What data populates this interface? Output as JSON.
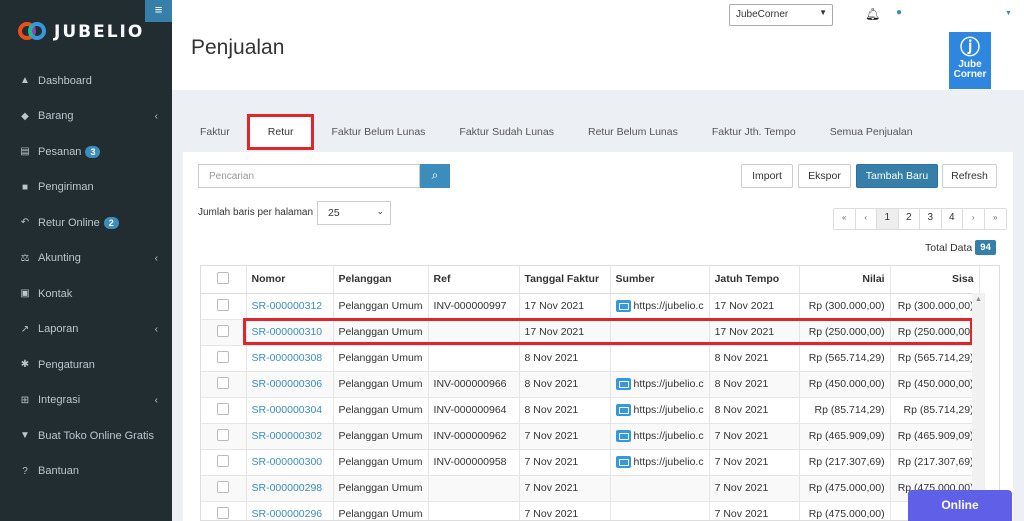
{
  "brand": {
    "name": "JUBELIO"
  },
  "topbar": {
    "store": "JubeCorner",
    "user_name": ""
  },
  "page": {
    "title": "Penjualan",
    "store_logo_text": "Jube Corner"
  },
  "sidebar": {
    "items": [
      {
        "label": "Dashboard",
        "icon": "area-chart-icon",
        "glyph": "▲",
        "badge": "",
        "has_children": false
      },
      {
        "label": "Barang",
        "icon": "cubes-icon",
        "glyph": "◆",
        "badge": "",
        "has_children": true
      },
      {
        "label": "Pesanan",
        "icon": "basket-icon",
        "glyph": "▤",
        "badge": "3",
        "has_children": false
      },
      {
        "label": "Pengiriman",
        "icon": "truck-icon",
        "glyph": "■",
        "badge": "",
        "has_children": false
      },
      {
        "label": "Retur Online",
        "icon": "reply-icon",
        "glyph": "↶",
        "badge": "2",
        "has_children": false
      },
      {
        "label": "Akunting",
        "icon": "balance-scale-icon",
        "glyph": "⚖",
        "badge": "",
        "has_children": true
      },
      {
        "label": "Kontak",
        "icon": "address-card-icon",
        "glyph": "▣",
        "badge": "",
        "has_children": false
      },
      {
        "label": "Laporan",
        "icon": "line-chart-icon",
        "glyph": "↗",
        "badge": "",
        "has_children": true
      },
      {
        "label": "Pengaturan",
        "icon": "gears-icon",
        "glyph": "✱",
        "badge": "",
        "has_children": false
      },
      {
        "label": "Integrasi",
        "icon": "sitemap-icon",
        "glyph": "⊞",
        "badge": "",
        "has_children": true
      },
      {
        "label": "Buat Toko Online Gratis",
        "icon": "cart-icon",
        "glyph": "▼",
        "badge": "",
        "has_children": false
      },
      {
        "label": "Bantuan",
        "icon": "question-circle-icon",
        "glyph": "?",
        "badge": "",
        "has_children": false
      }
    ]
  },
  "tabs": [
    {
      "label": "Faktur",
      "active": false
    },
    {
      "label": "Retur",
      "active": true
    },
    {
      "label": "Faktur Belum Lunas",
      "active": false
    },
    {
      "label": "Faktur Sudah Lunas",
      "active": false
    },
    {
      "label": "Retur Belum Lunas",
      "active": false
    },
    {
      "label": "Faktur Jth. Tempo",
      "active": false
    },
    {
      "label": "Semua Penjualan",
      "active": false
    }
  ],
  "toolbar": {
    "search_placeholder": "Pencarian",
    "import_label": "Import",
    "export_label": "Ekspor",
    "add_label": "Tambah Baru",
    "refresh_label": "Refresh"
  },
  "rows_per_page": {
    "label": "Jumlah baris per halaman",
    "value": "25"
  },
  "pagination": {
    "first": "«",
    "prev": "‹",
    "pages": [
      "1",
      "2",
      "3",
      "4"
    ],
    "current": "1",
    "next": "›",
    "last": "»"
  },
  "total": {
    "label": "Total Data",
    "count": "94"
  },
  "table": {
    "columns": [
      "Nomor",
      "Pelanggan",
      "Ref",
      "Tanggal Faktur",
      "Sumber",
      "Jatuh Tempo",
      "Nilai",
      "Sisa"
    ],
    "rows": [
      {
        "nomor": "SR-000000312",
        "pelanggan": "Pelanggan Umum",
        "ref": "INV-000000997",
        "tanggal": "17 Nov 2021",
        "sumber": "https://jubelio.c",
        "jatuh_tempo": "17 Nov 2021",
        "nilai": "Rp (300.000,00)",
        "sisa": "Rp (300.000,00)"
      },
      {
        "nomor": "SR-000000310",
        "pelanggan": "Pelanggan Umum",
        "ref": "",
        "tanggal": "17 Nov 2021",
        "sumber": "",
        "jatuh_tempo": "17 Nov 2021",
        "nilai": "Rp (250.000,00)",
        "sisa": "Rp (250.000,00)"
      },
      {
        "nomor": "SR-000000308",
        "pelanggan": "Pelanggan Umum",
        "ref": "",
        "tanggal": "8 Nov 2021",
        "sumber": "",
        "jatuh_tempo": "8 Nov 2021",
        "nilai": "Rp (565.714,29)",
        "sisa": "Rp (565.714,29)"
      },
      {
        "nomor": "SR-000000306",
        "pelanggan": "Pelanggan Umum",
        "ref": "INV-000000966",
        "tanggal": "8 Nov 2021",
        "sumber": "https://jubelio.c",
        "jatuh_tempo": "8 Nov 2021",
        "nilai": "Rp (450.000,00)",
        "sisa": "Rp (450.000,00)"
      },
      {
        "nomor": "SR-000000304",
        "pelanggan": "Pelanggan Umum",
        "ref": "INV-000000964",
        "tanggal": "8 Nov 2021",
        "sumber": "https://jubelio.c",
        "jatuh_tempo": "8 Nov 2021",
        "nilai": "Rp (85.714,29)",
        "sisa": "Rp (85.714,29)"
      },
      {
        "nomor": "SR-000000302",
        "pelanggan": "Pelanggan Umum",
        "ref": "INV-000000962",
        "tanggal": "7 Nov 2021",
        "sumber": "https://jubelio.c",
        "jatuh_tempo": "7 Nov 2021",
        "nilai": "Rp (465.909,09)",
        "sisa": "Rp (465.909,09)"
      },
      {
        "nomor": "SR-000000300",
        "pelanggan": "Pelanggan Umum",
        "ref": "INV-000000958",
        "tanggal": "7 Nov 2021",
        "sumber": "https://jubelio.c",
        "jatuh_tempo": "7 Nov 2021",
        "nilai": "Rp (217.307,69)",
        "sisa": "Rp (217.307,69)"
      },
      {
        "nomor": "SR-000000298",
        "pelanggan": "Pelanggan Umum",
        "ref": "",
        "tanggal": "7 Nov 2021",
        "sumber": "",
        "jatuh_tempo": "7 Nov 2021",
        "nilai": "Rp (475.000,00)",
        "sisa": "Rp (475.000,00)"
      },
      {
        "nomor": "SR-000000296",
        "pelanggan": "Pelanggan Umum",
        "ref": "",
        "tanggal": "7 Nov 2021",
        "sumber": "",
        "jatuh_tempo": "7 Nov 2021",
        "nilai": "Rp (475.000,00)",
        "sisa": "Rp"
      }
    ]
  },
  "chat": {
    "label": "Online"
  },
  "colors": {
    "sidebar": "#222d32",
    "accent": "#367fa9",
    "highlight": "#e0252b",
    "chat": "#5f5fe8"
  }
}
